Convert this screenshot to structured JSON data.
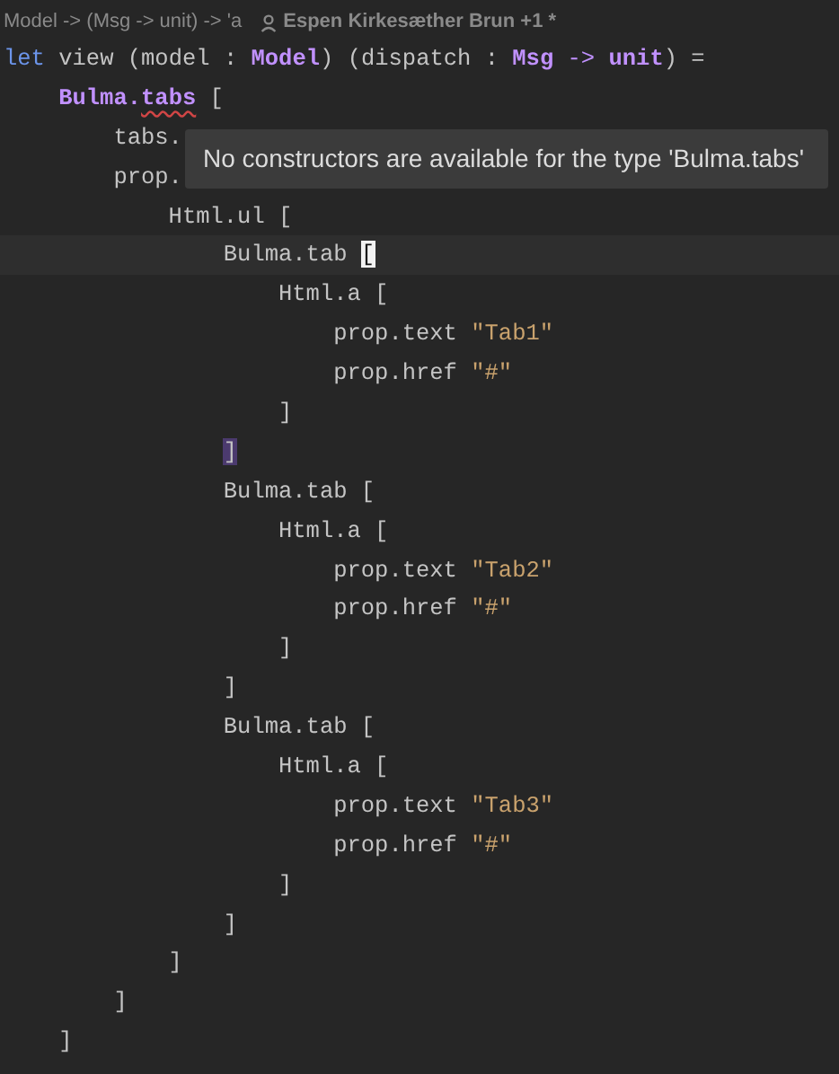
{
  "hint_bar": {
    "signature": "Model -> (Msg -> unit) -> 'a",
    "authors": "Espen Kirkesæther Brun +1 *"
  },
  "lines": [
    {
      "tokens": [
        {
          "text": "let",
          "kind": "keyword"
        },
        {
          "text": " view (model : ",
          "kind": "plain"
        },
        {
          "text": "Model",
          "kind": "type"
        },
        {
          "text": ") (dispatch : ",
          "kind": "plain"
        },
        {
          "text": "Msg",
          "kind": "type"
        },
        {
          "text": " -> ",
          "kind": "operator"
        },
        {
          "text": "unit",
          "kind": "type"
        },
        {
          "text": ") =",
          "kind": "plain"
        }
      ]
    },
    {
      "tokens": [
        {
          "text": "    Bulma.",
          "kind": "type"
        },
        {
          "text": "tabs",
          "kind": "error"
        },
        {
          "text": " [",
          "kind": "plain"
        }
      ]
    },
    {
      "tokens": [
        {
          "text": "        tabs.",
          "kind": "plain"
        }
      ]
    },
    {
      "tokens": [
        {
          "text": "        prop.",
          "kind": "plain"
        }
      ]
    },
    {
      "tokens": [
        {
          "text": "            Html.ul [",
          "kind": "plain"
        }
      ]
    },
    {
      "current": true,
      "tokens": [
        {
          "text": "                Bulma.tab ",
          "kind": "plain"
        },
        {
          "text": "[",
          "kind": "caret"
        }
      ]
    },
    {
      "tokens": [
        {
          "text": "                    Html.a [",
          "kind": "plain"
        }
      ]
    },
    {
      "tokens": [
        {
          "text": "                        prop.text ",
          "kind": "plain"
        },
        {
          "text": "\"Tab1\"",
          "kind": "string"
        }
      ]
    },
    {
      "tokens": [
        {
          "text": "                        prop.href ",
          "kind": "plain"
        },
        {
          "text": "\"#\"",
          "kind": "string"
        }
      ]
    },
    {
      "tokens": [
        {
          "text": "                    ]",
          "kind": "plain"
        }
      ]
    },
    {
      "tokens": [
        {
          "text": "                ]",
          "kind": "match"
        }
      ]
    },
    {
      "tokens": [
        {
          "text": "                Bulma.tab [",
          "kind": "plain"
        }
      ]
    },
    {
      "tokens": [
        {
          "text": "                    Html.a [",
          "kind": "plain"
        }
      ]
    },
    {
      "tokens": [
        {
          "text": "                        prop.text ",
          "kind": "plain"
        },
        {
          "text": "\"Tab2\"",
          "kind": "string"
        }
      ]
    },
    {
      "tokens": [
        {
          "text": "                        prop.href ",
          "kind": "plain"
        },
        {
          "text": "\"#\"",
          "kind": "string"
        }
      ]
    },
    {
      "tokens": [
        {
          "text": "                    ]",
          "kind": "plain"
        }
      ]
    },
    {
      "tokens": [
        {
          "text": "                ]",
          "kind": "plain"
        }
      ]
    },
    {
      "tokens": [
        {
          "text": "                Bulma.tab [",
          "kind": "plain"
        }
      ]
    },
    {
      "tokens": [
        {
          "text": "                    Html.a [",
          "kind": "plain"
        }
      ]
    },
    {
      "tokens": [
        {
          "text": "                        prop.text ",
          "kind": "plain"
        },
        {
          "text": "\"Tab3\"",
          "kind": "string"
        }
      ]
    },
    {
      "tokens": [
        {
          "text": "                        prop.href ",
          "kind": "plain"
        },
        {
          "text": "\"#\"",
          "kind": "string"
        }
      ]
    },
    {
      "tokens": [
        {
          "text": "                    ]",
          "kind": "plain"
        }
      ]
    },
    {
      "tokens": [
        {
          "text": "                ]",
          "kind": "plain"
        }
      ]
    },
    {
      "tokens": [
        {
          "text": "            ]",
          "kind": "plain"
        }
      ]
    },
    {
      "tokens": [
        {
          "text": "        ]",
          "kind": "plain"
        }
      ]
    },
    {
      "tokens": [
        {
          "text": "    ]",
          "kind": "plain"
        }
      ]
    }
  ],
  "tooltip": {
    "text": "No constructors are available for the type 'Bulma.tabs'"
  }
}
